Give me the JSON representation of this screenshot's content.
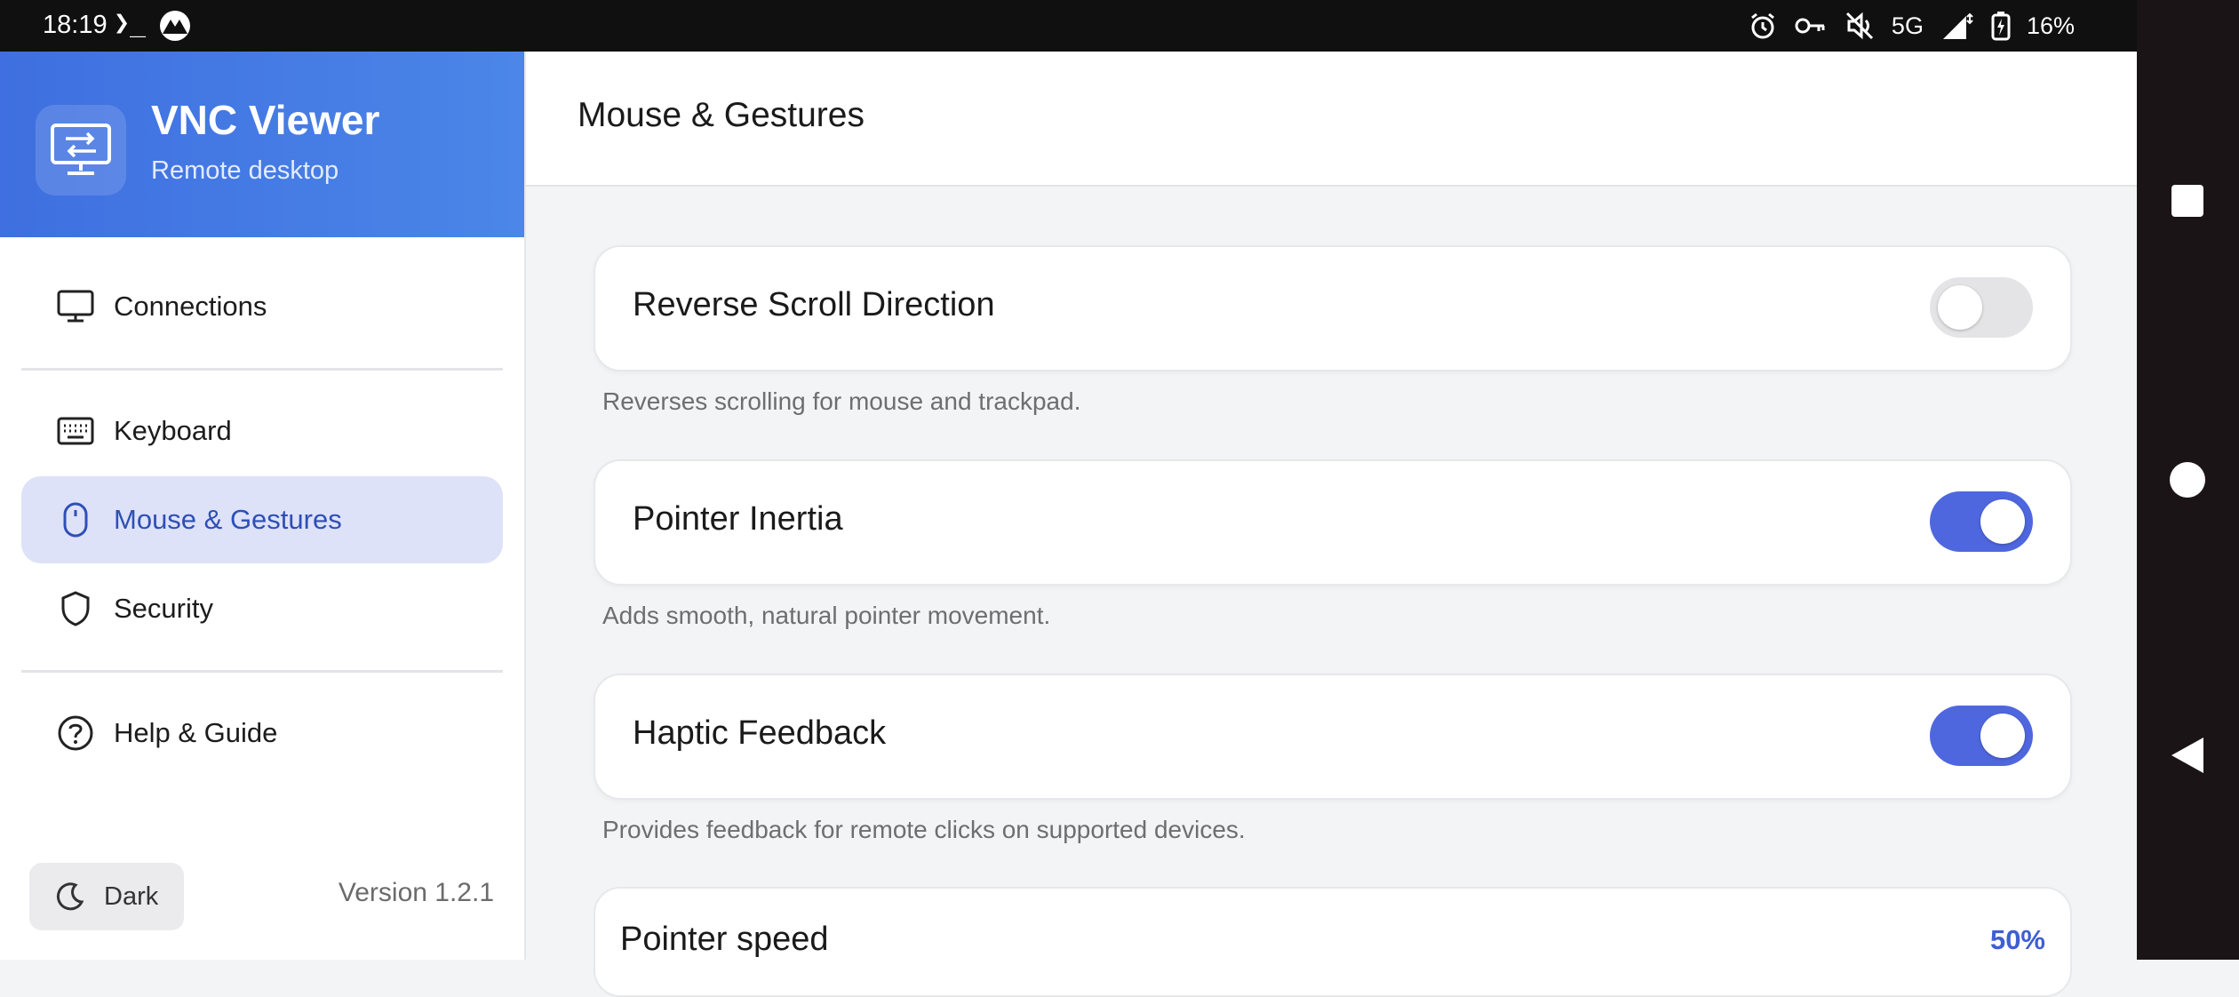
{
  "status_bar": {
    "time": "18:19",
    "network": "5G",
    "battery": "16%"
  },
  "sidebar": {
    "brand": {
      "title": "VNC Viewer",
      "subtitle": "Remote desktop"
    },
    "items": [
      {
        "label": "Connections",
        "icon": "monitor-icon"
      },
      {
        "label": "Keyboard",
        "icon": "keyboard-icon"
      },
      {
        "label": "Mouse & Gestures",
        "icon": "mouse-icon",
        "active": true
      },
      {
        "label": "Security",
        "icon": "shield-icon"
      },
      {
        "label": "Help & Guide",
        "icon": "help-icon"
      }
    ],
    "theme_label": "Dark",
    "version": "Version 1.2.1"
  },
  "main": {
    "title": "Mouse & Gestures",
    "settings": [
      {
        "title": "Reverse Scroll Direction",
        "description": "Reverses scrolling for mouse and trackpad.",
        "enabled": false
      },
      {
        "title": "Pointer Inertia",
        "description": "Adds smooth, natural pointer movement.",
        "enabled": true
      },
      {
        "title": "Haptic Feedback",
        "description": "Provides feedback for remote clicks on supported devices.",
        "enabled": true
      }
    ],
    "pointer_speed": {
      "label": "Pointer speed",
      "value": "50%"
    }
  },
  "colors": {
    "accent": "#4f67de",
    "brand_gradient_start": "#3f6fe0",
    "brand_gradient_end": "#4b86e8",
    "active_nav_bg": "#dde2f8"
  }
}
